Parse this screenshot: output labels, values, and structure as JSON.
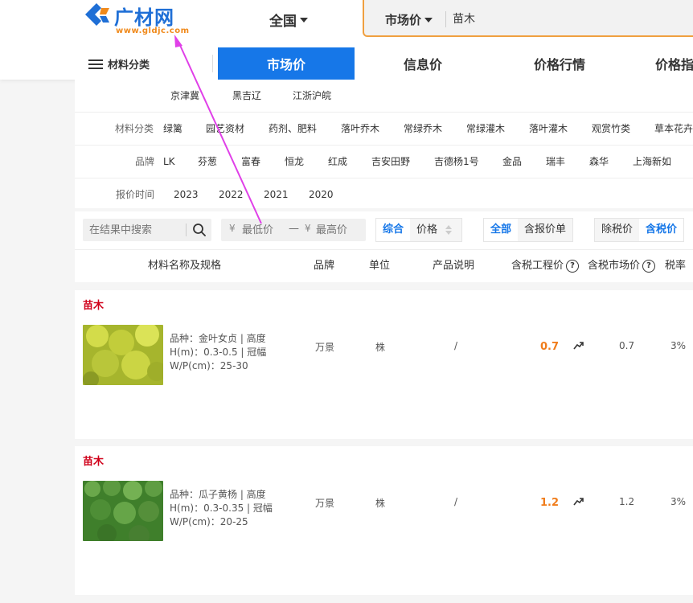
{
  "header": {
    "logo_text": "广材网",
    "logo_url": "www.gldjc.com",
    "region": "全国",
    "search_type": "市场价",
    "search_value": "苗木"
  },
  "nav": {
    "category_label": "材料分类",
    "tabs": [
      {
        "label": "市场价",
        "active": true
      },
      {
        "label": "信息价",
        "active": false
      },
      {
        "label": "价格行情",
        "active": false
      },
      {
        "label": "价格指"
      }
    ]
  },
  "filters": {
    "regions": [
      "京津冀",
      "黑吉辽",
      "江浙沪皖"
    ],
    "category_label": "材料分类",
    "categories": [
      "绿篱",
      "园艺资材",
      "药剂、肥料",
      "落叶乔木",
      "常绿乔木",
      "常绿灌木",
      "落叶灌木",
      "观赏竹类",
      "草本花卉"
    ],
    "brand_label": "品牌",
    "brands": [
      "LK",
      "芬葱",
      "富春",
      "恒龙",
      "红成",
      "吉安田野",
      "吉德杨1号",
      "金品",
      "瑞丰",
      "森华",
      "上海新如"
    ],
    "time_label": "报价时间",
    "years": [
      "2023",
      "2022",
      "2021",
      "2020"
    ]
  },
  "toolbar": {
    "search_placeholder": "在结果中搜索",
    "min_price_placeholder": "最低价",
    "max_price_placeholder": "最高价",
    "yen": "¥",
    "dash": "—",
    "sort_default": "综合",
    "sort_price": "价格",
    "type_all": "全部",
    "type_quote": "含报价单",
    "tax_excl": "除税价",
    "tax_incl": "含税价"
  },
  "table": {
    "columns": {
      "name": "材料名称及规格",
      "brand": "品牌",
      "unit": "单位",
      "desc": "产品说明",
      "eng_price": "含税工程价",
      "market_price": "含税市场价",
      "tax": "税率"
    },
    "rows": [
      {
        "category": "苗木",
        "spec_line1": "品种：金叶女贞 | 高度",
        "spec_line2": "H(m)：0.3-0.5 | 冠幅",
        "spec_line3": "W/P(cm)：25-30",
        "brand": "万景",
        "unit": "株",
        "desc": "/",
        "eng_price": "0.7",
        "market_price": "0.7",
        "tax": "3%",
        "thumb_color": "#b8c83a"
      },
      {
        "category": "苗木",
        "spec_line1": "品种：瓜子黄杨 | 高度",
        "spec_line2": "H(m)：0.3-0.35 | 冠幅",
        "spec_line3": "W/P(cm)：20-25",
        "brand": "万景",
        "unit": "株",
        "desc": "/",
        "eng_price": "1.2",
        "market_price": "1.2",
        "tax": "3%",
        "thumb_color": "#4f8f35"
      }
    ]
  },
  "colors": {
    "accent": "#1677e8",
    "price": "#f07c1a",
    "category": "#d0021b",
    "annotation": "#e040e8"
  }
}
